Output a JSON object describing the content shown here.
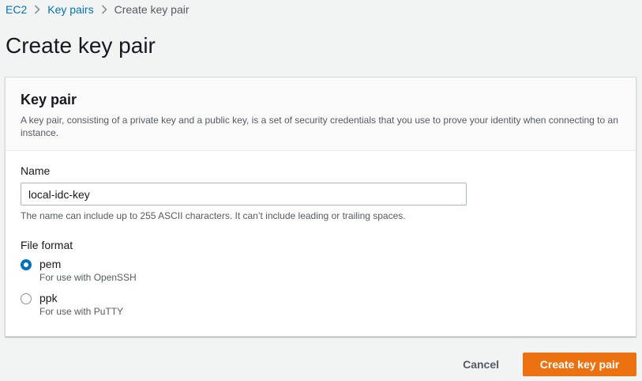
{
  "breadcrumb": {
    "items": [
      "EC2",
      "Key pairs"
    ],
    "current": "Create key pair"
  },
  "page_title": "Create key pair",
  "panel": {
    "title": "Key pair",
    "description": "A key pair, consisting of a private key and a public key, is a set of security credentials that you use to prove your identity when connecting to an instance."
  },
  "name_field": {
    "label": "Name",
    "value": "local-idc-key",
    "hint": "The name can include up to 255 ASCII characters. It can’t include leading or trailing spaces."
  },
  "file_format": {
    "label": "File format",
    "options": [
      {
        "label": "pem",
        "description": "For use with OpenSSH",
        "selected": true
      },
      {
        "label": "ppk",
        "description": "For use with PuTTY",
        "selected": false
      }
    ]
  },
  "actions": {
    "cancel_label": "Cancel",
    "create_label": "Create key pair"
  },
  "colors": {
    "link": "#0073bb",
    "primary_button": "#ec7211",
    "background": "#f2f3f3"
  },
  "icons": {
    "breadcrumb_separator": "chevron-right-icon"
  }
}
